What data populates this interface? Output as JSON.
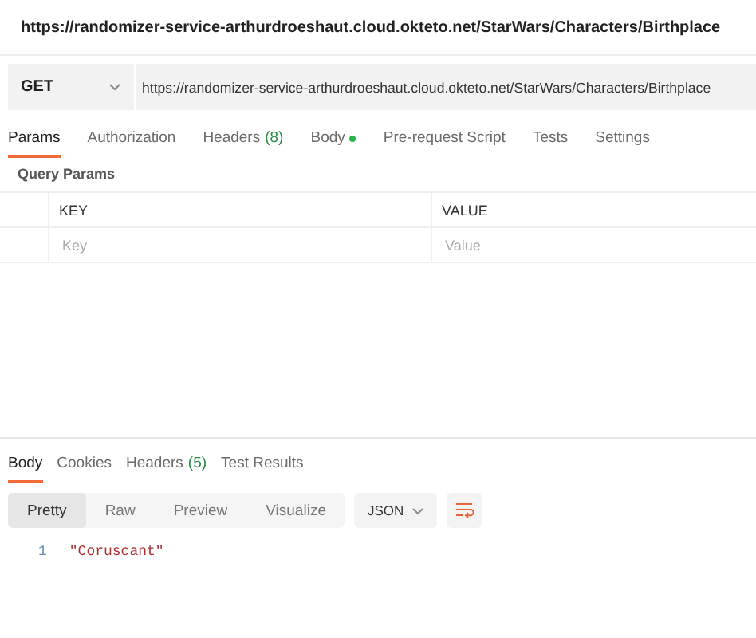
{
  "title": "https://randomizer-service-arthurdroeshaut.cloud.okteto.net/StarWars/Characters/Birthplace",
  "request": {
    "method": "GET",
    "url": "https://randomizer-service-arthurdroeshaut.cloud.okteto.net/StarWars/Characters/Birthplace"
  },
  "request_tabs": [
    {
      "label": "Params",
      "selected": true
    },
    {
      "label": "Authorization",
      "selected": false
    },
    {
      "label": "Headers",
      "count": "(8)",
      "selected": false
    },
    {
      "label": "Body",
      "dot": true,
      "selected": false
    },
    {
      "label": "Pre-request Script",
      "selected": false
    },
    {
      "label": "Tests",
      "selected": false
    },
    {
      "label": "Settings",
      "selected": false
    }
  ],
  "params": {
    "title": "Query Params",
    "columns": [
      "KEY",
      "VALUE"
    ],
    "placeholders": [
      "Key",
      "Value"
    ]
  },
  "response_tabs": [
    {
      "label": "Body",
      "selected": true
    },
    {
      "label": "Cookies",
      "selected": false
    },
    {
      "label": "Headers",
      "count": "(5)",
      "selected": false
    },
    {
      "label": "Test Results",
      "selected": false
    }
  ],
  "views": [
    {
      "label": "Pretty",
      "selected": true
    },
    {
      "label": "Raw",
      "selected": false
    },
    {
      "label": "Preview",
      "selected": false
    },
    {
      "label": "Visualize",
      "selected": false
    }
  ],
  "format": "JSON",
  "lines": [
    {
      "number": "1",
      "text": "\"Coruscant\""
    }
  ]
}
